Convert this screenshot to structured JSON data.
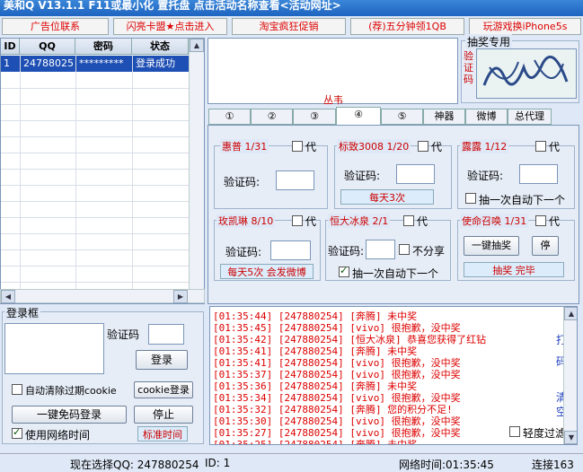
{
  "title": "美和Q V13.1.1 F11或最小化 置托盘 点击活动名称查看<活动网址>",
  "ads": [
    "广告位联系",
    "闪亮卡盟★点击进入",
    "淘宝疯狂促销",
    "(荐)五分钟领1QB",
    "玩游戏换iPhone5s"
  ],
  "table": {
    "headers": [
      "ID",
      "QQ",
      "密码",
      "状态"
    ],
    "row": {
      "id": "1",
      "qq": "24788025",
      "pwd": "*********",
      "status": "登录成功"
    }
  },
  "captcha_box": {
    "title": "抽奖专用",
    "side_label": "验证码",
    "preview_text": "丛韦"
  },
  "tabs": [
    "①",
    "②",
    "③",
    "④",
    "⑤",
    "神器",
    "微博",
    "总代理"
  ],
  "lottery": [
    {
      "name": "惠普 1/31",
      "daibox": "代",
      "code_label": "验证码:"
    },
    {
      "name": "标致3008 1/20",
      "daibox": "代",
      "code_label": "验证码:",
      "note": "每天3次"
    },
    {
      "name": "露露 1/12",
      "daibox": "代",
      "code_label": "验证码:",
      "extra": "抽一次自动下一个"
    },
    {
      "name": "玫凯琳 8/10",
      "daibox": "代",
      "code_label": "验证码:",
      "note": "每天5次 会发微博"
    },
    {
      "name": "恒大冰泉 2/1",
      "daibox": "代",
      "code_label": "验证码:",
      "noshare": "不分享",
      "extra": "抽一次自动下一个"
    },
    {
      "name": "使命召唤 1/31",
      "daibox": "代",
      "btn1": "一键抽奖",
      "btn2": "停",
      "note": "抽奖 完毕"
    }
  ],
  "login": {
    "title": "登录框",
    "code_label": "验证码",
    "login_btn": "登录",
    "auto_clear": "自动清除过期cookie",
    "cookie_login": "cookie登录",
    "one_key": "一键免码登录",
    "stop": "停止",
    "use_net_time": "使用网络时间",
    "std_time": "标准时间"
  },
  "log": [
    "[01:35:44] [247880254] [奔腾] 未中奖",
    "[01:35:45] [247880254] [vivo] 很抱歉，没中奖",
    "[01:35:42] [247880254] [恒大冰泉] 恭喜您获得了红钻",
    "[01:35:41] [247880254] [奔腾] 未中奖",
    "[01:35:41] [247880254] [vivo] 很抱歉，没中奖",
    "[01:35:37] [247880254] [vivo] 很抱歉，没中奖",
    "[01:35:36] [247880254] [奔腾] 未中奖",
    "[01:35:34] [247880254] [vivo] 很抱歉，没中奖",
    "[01:35:32] [247880254] [奔腾] 您的积分不足!",
    "[01:35:30] [247880254] [vivo] 很抱歉，没中奖",
    "[01:35:27] [247880254] [vivo] 很抱歉，没中奖",
    "[01:35:25] [247880254] [奔腾] 未中奖"
  ],
  "log_side": {
    "print": "打",
    "code": "码",
    "clear1": "清",
    "clear2": "空",
    "light_filter": "轻度过滤"
  },
  "status": {
    "current": "现在选择QQ: 247880254",
    "id": "ID: 1",
    "nettime": "网络时间:01:35:45",
    "right": "连接163"
  }
}
